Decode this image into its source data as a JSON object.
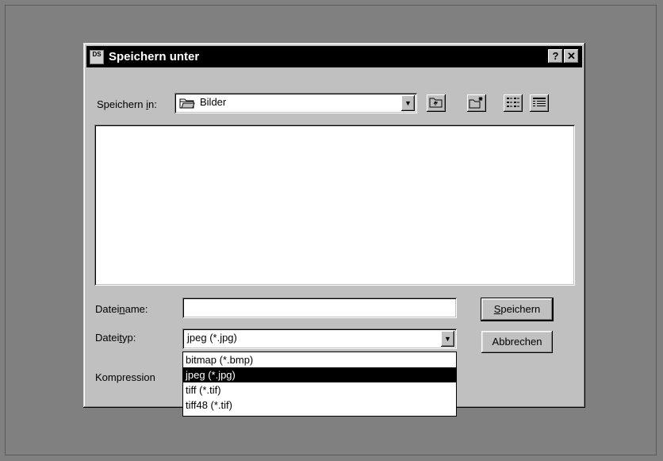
{
  "dialog": {
    "title": "Speichern unter",
    "icon_text": "DS",
    "help_label": "?",
    "close_label": "✕"
  },
  "save_in": {
    "label_pre": "Speichern ",
    "label_u": "i",
    "label_post": "n:",
    "value": "Bilder",
    "folder_icon": "folder-icon"
  },
  "toolbar": {
    "up_icon": "folder-up-icon",
    "new_folder_icon": "new-folder-icon",
    "list_icon": "list-view-icon",
    "details_icon": "details-view-icon"
  },
  "filename": {
    "label_pre": "Datei",
    "label_u": "n",
    "label_post": "ame:",
    "value": ""
  },
  "filetype": {
    "label_pre": "Datei",
    "label_u": "t",
    "label_post": "yp:",
    "value": "jpeg (*.jpg)",
    "options": [
      "bitmap (*.bmp)",
      "jpeg (*.jpg)",
      "tiff (*.tif)",
      "tiff48 (*.tif)"
    ],
    "selected_index": 1
  },
  "compression": {
    "label": "Kompression"
  },
  "buttons": {
    "save_u": "S",
    "save_post": "peichern",
    "cancel": "Abbrechen"
  }
}
